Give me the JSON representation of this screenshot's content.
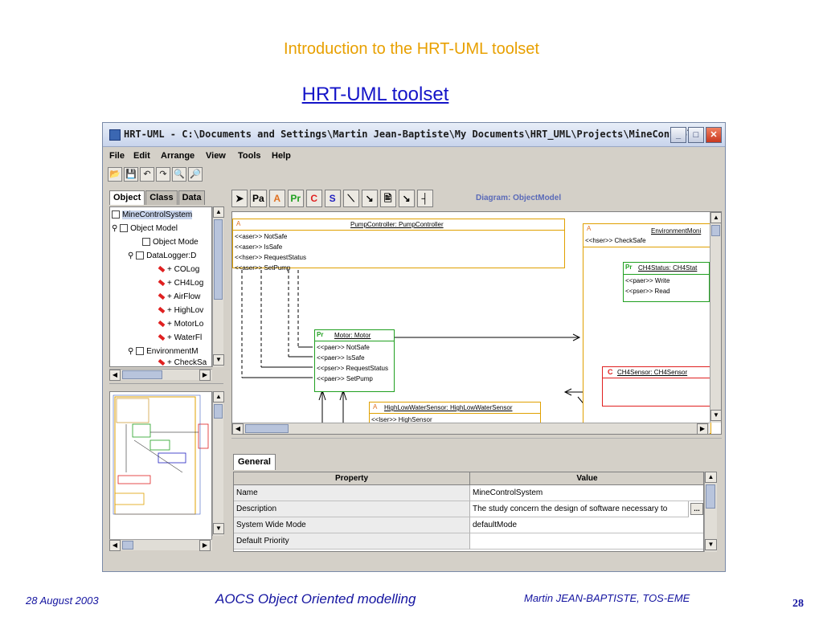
{
  "slide": {
    "title": "Introduction to the HRT-UML toolset",
    "subtitle": "HRT-UML toolset"
  },
  "window": {
    "title": "HRT-UML - C:\\Documents and Settings\\Martin Jean-Baptiste\\My Documents\\HRT_UML\\Projects\\MineControlS...",
    "controls": {
      "minimize": "_",
      "maximize": "□",
      "close": "✕"
    }
  },
  "menu": [
    "File",
    "Edit",
    "Arrange",
    "View",
    "Tools",
    "Help"
  ],
  "toolbar_icons": [
    "open-icon",
    "save-icon",
    "undo-icon",
    "redo-icon",
    "zoom-in-icon",
    "zoom-out-icon"
  ],
  "left_tabs": [
    "Object",
    "Class",
    "Data"
  ],
  "tree": [
    {
      "label": "MineControlSystem",
      "selected": true
    },
    {
      "label": "Object Model"
    },
    {
      "label": "Object Mode"
    },
    {
      "label": "DataLogger:D"
    },
    {
      "label": "+ COLog"
    },
    {
      "label": "+ CH4Log"
    },
    {
      "label": "+ AirFlow"
    },
    {
      "label": "+ HighLov"
    },
    {
      "label": "+ MotorLo"
    },
    {
      "label": "+ WaterFl"
    },
    {
      "label": "EnvironmentM"
    },
    {
      "label": "+ CheckSa"
    }
  ],
  "diagram_tools": [
    "Pa",
    "A",
    "Pr",
    "C",
    "S"
  ],
  "diagram_label": "Diagram: ObjectModel",
  "uml": {
    "pump": {
      "marker": "A",
      "title": "PumpController: PumpController",
      "ops": [
        "<<aser>> NotSafe",
        "<<aser>> IsSafe",
        "<<hser>> RequestStatus",
        "<<aser>> SetPump"
      ]
    },
    "env": {
      "marker": "A",
      "title": "EnvironmentMoni",
      "ops": [
        "<<hser>> CheckSafe"
      ]
    },
    "ch4status": {
      "marker": "Pr",
      "title": "CH4Status: CH4Stat",
      "ops": [
        "<<paer>> Write",
        "<<pser>> Read"
      ]
    },
    "motor": {
      "marker": "Pr",
      "title": "Motor: Motor",
      "ops": [
        "<<paer>> NotSafe",
        "<<paer>> IsSafe",
        "<<pser>> RequestStatus",
        "<<paer>> SetPump"
      ]
    },
    "ch4sensor": {
      "marker": "C",
      "title": "CH4Sensor: CH4Sensor"
    },
    "hlw": {
      "marker": "A",
      "title": "HighLowWaterSensor: HighLowWaterSensor",
      "ops": [
        "<<lser>> HighSensor"
      ]
    }
  },
  "properties": {
    "tab": "General",
    "headers": [
      "Property",
      "Value"
    ],
    "rows": [
      {
        "key": "Name",
        "value": "MineControlSystem"
      },
      {
        "key": "Description",
        "value": "The study concern the design of software necessary to"
      },
      {
        "key": "System Wide Mode",
        "value": "defaultMode"
      },
      {
        "key": "Default Priority",
        "value": ""
      }
    ],
    "ellipsis": "..."
  },
  "footer": {
    "date": "28 August 2003",
    "middle": "AOCS Object Oriented modelling",
    "author": "Martin JEAN-BAPTISTE, TOS-EME",
    "page": "28"
  }
}
